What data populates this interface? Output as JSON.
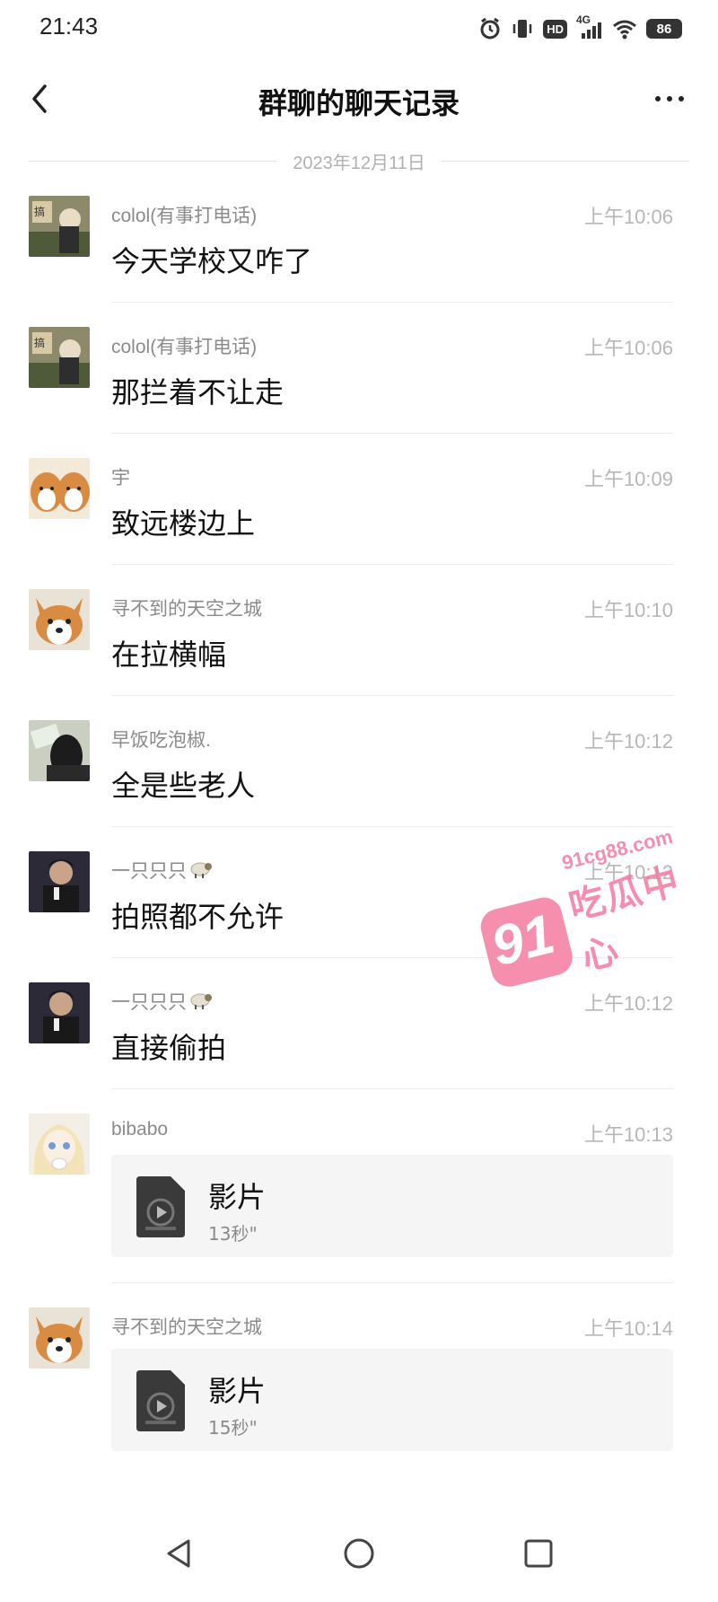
{
  "status_bar": {
    "time": "21:43",
    "icons": [
      "alarm-icon",
      "vibrate-icon",
      "hd-icon",
      "signal-4g-icon",
      "wifi-icon"
    ],
    "hd_label": "HD",
    "network_label": "4G",
    "battery": "86"
  },
  "header": {
    "title": "群聊的聊天记录",
    "back_icon": "chevron-left-icon",
    "more_icon": "more-dots-icon"
  },
  "date_separator": "2023年12月11日",
  "messages": [
    {
      "sender": "colol(有事打电话)",
      "time": "上午10:06",
      "text": "今天学校又咋了",
      "avatar": "anime-avatar"
    },
    {
      "sender": "colol(有事打电话)",
      "time": "上午10:06",
      "text": "那拦着不让走",
      "avatar": "anime-avatar"
    },
    {
      "sender": "宇",
      "time": "上午10:09",
      "text": "致远楼边上",
      "avatar": "shiba-dogs-avatar"
    },
    {
      "sender": "寻不到的天空之城",
      "time": "上午10:10",
      "text": "在拉横幅",
      "avatar": "corgi-avatar"
    },
    {
      "sender": "早饭吃泡椒.",
      "time": "上午10:12",
      "text": "全是些老人",
      "avatar": "dark-photo-avatar"
    },
    {
      "sender": "一只只只",
      "time": "上午10:12",
      "text": "拍照都不允许",
      "avatar": "man-portrait-avatar",
      "sender_icon": "sheep-icon"
    },
    {
      "sender": "一只只只",
      "time": "上午10:12",
      "text": "直接偷拍",
      "avatar": "man-portrait-avatar",
      "sender_icon": "sheep-icon"
    },
    {
      "sender": "bibabo",
      "time": "上午10:13",
      "avatar": "anime-girl-avatar",
      "file": {
        "name": "影片",
        "duration": "13秒\"",
        "icon": "video-file-icon"
      }
    },
    {
      "sender": "寻不到的天空之城",
      "time": "上午10:14",
      "avatar": "corgi-avatar",
      "file": {
        "name": "影片",
        "duration": "15秒\"",
        "icon": "video-file-icon"
      }
    }
  ],
  "watermark": {
    "number": "91",
    "url": "91cg88.com",
    "text": "吃瓜中心",
    "color": "#f47ba0"
  },
  "nav_bar": {
    "icons": [
      "back-triangle-icon",
      "home-circle-icon",
      "recents-square-icon"
    ]
  }
}
